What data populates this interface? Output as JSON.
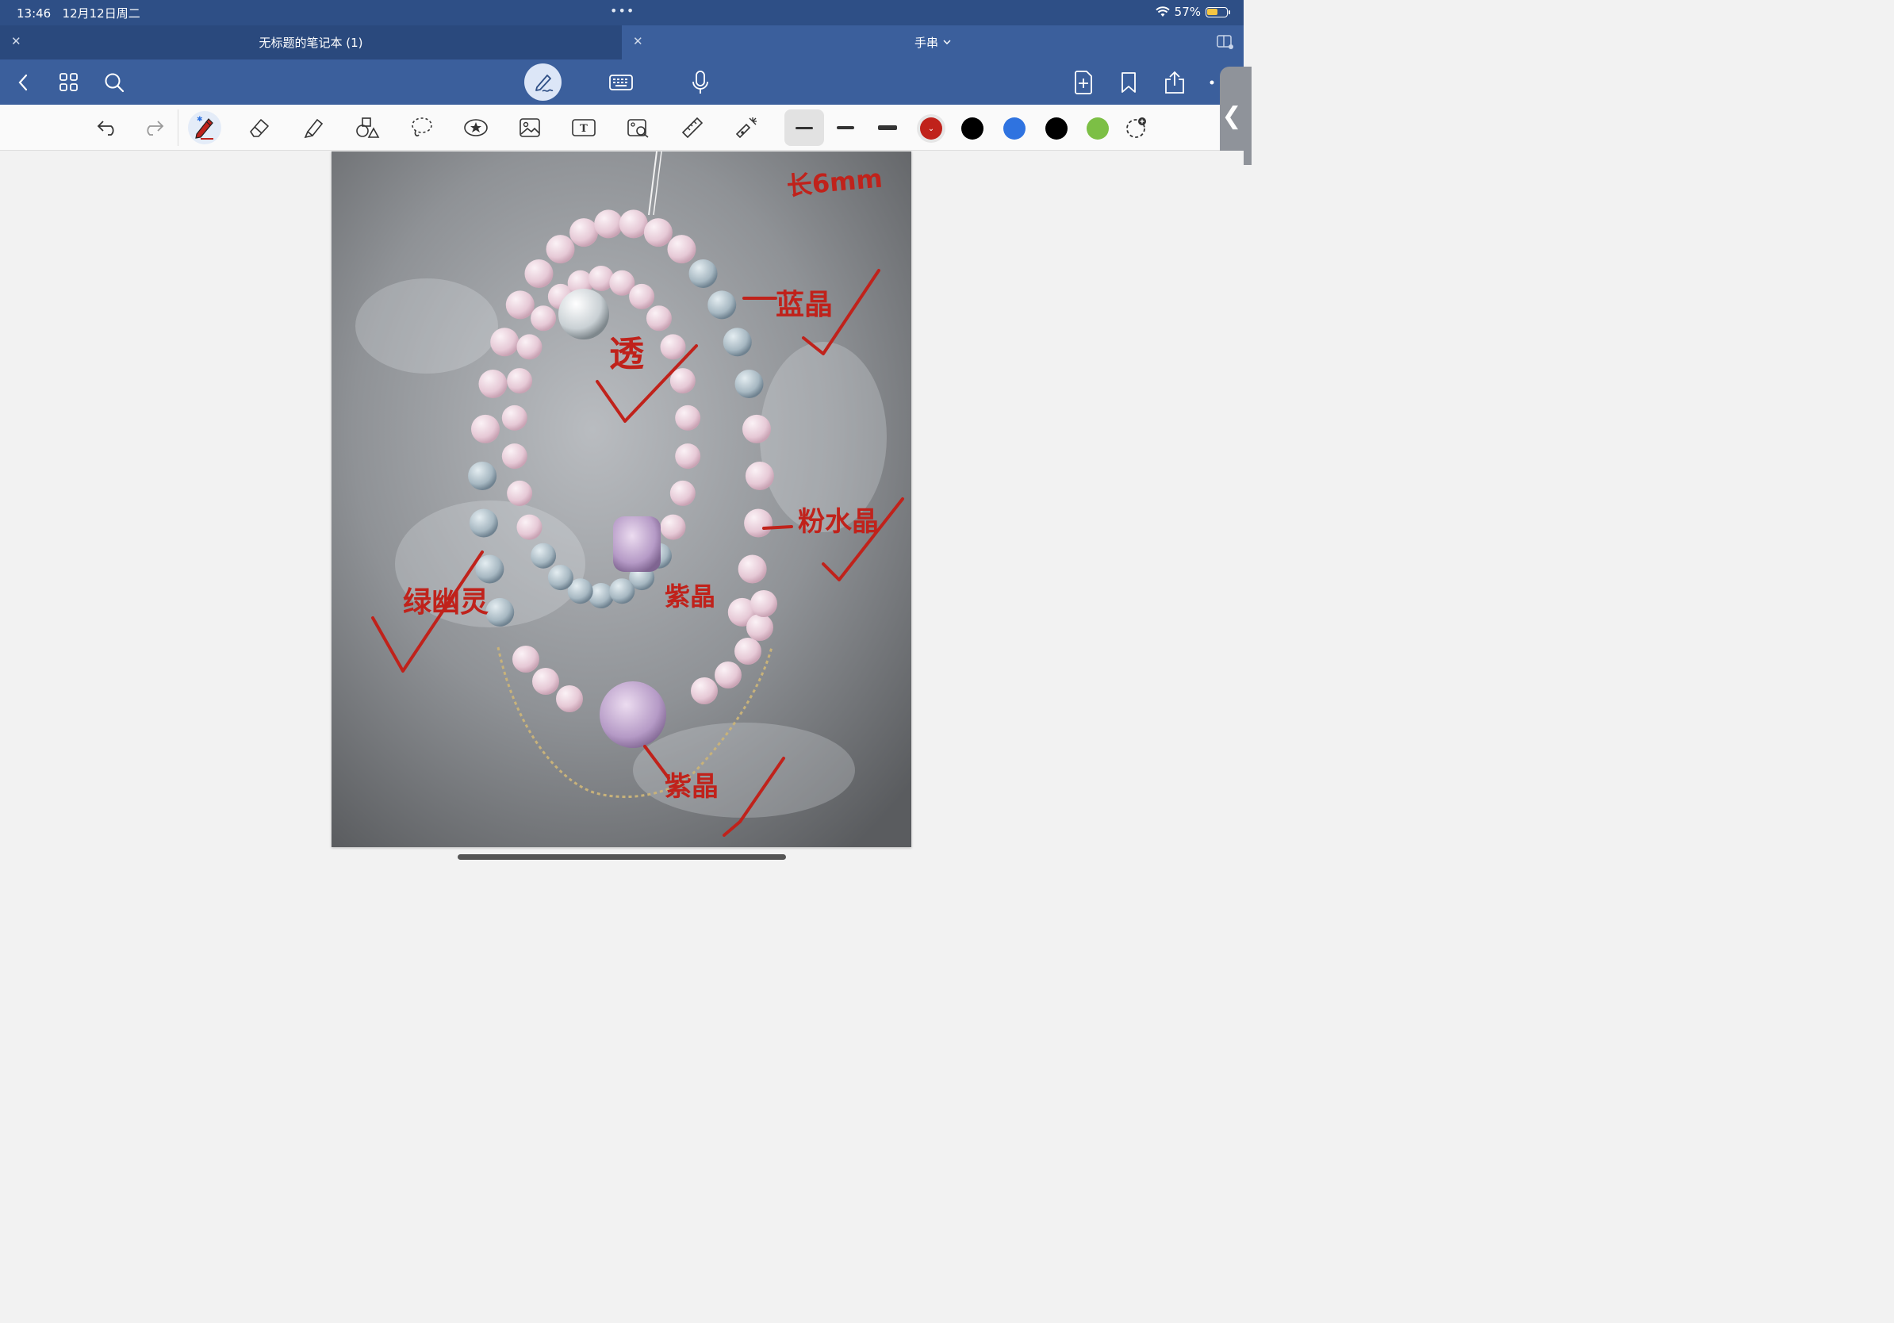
{
  "status_bar": {
    "time": "13:46",
    "date": "12月12日周二",
    "battery_percent": "57%",
    "battery_level": 0.57
  },
  "tabs": [
    {
      "title": "无标题的笔记本 (1)",
      "active": false
    },
    {
      "title": "手串",
      "active": true
    }
  ],
  "toolbar": {
    "tools": [
      "undo-icon",
      "redo-icon",
      "pen-icon",
      "eraser-icon",
      "highlighter-icon",
      "shapes-icon",
      "lasso-icon",
      "sticker-icon",
      "image-icon",
      "text-box-icon",
      "camera-icon",
      "ruler-icon",
      "laser-pointer-icon"
    ],
    "selected_tool": "pen-icon",
    "stroke_sizes": [
      "thin",
      "medium",
      "thick"
    ],
    "selected_stroke": "thin",
    "colors": [
      "#c0221b",
      "#000000",
      "#2f73e0",
      "#000000",
      "#7cbf45"
    ],
    "selected_color": "#c0221b"
  },
  "annotations": {
    "size_note": "长6mm",
    "labels": [
      "蓝晶",
      "透",
      "粉水晶",
      "紫晶",
      "绿幽灵",
      "紫晶"
    ]
  }
}
